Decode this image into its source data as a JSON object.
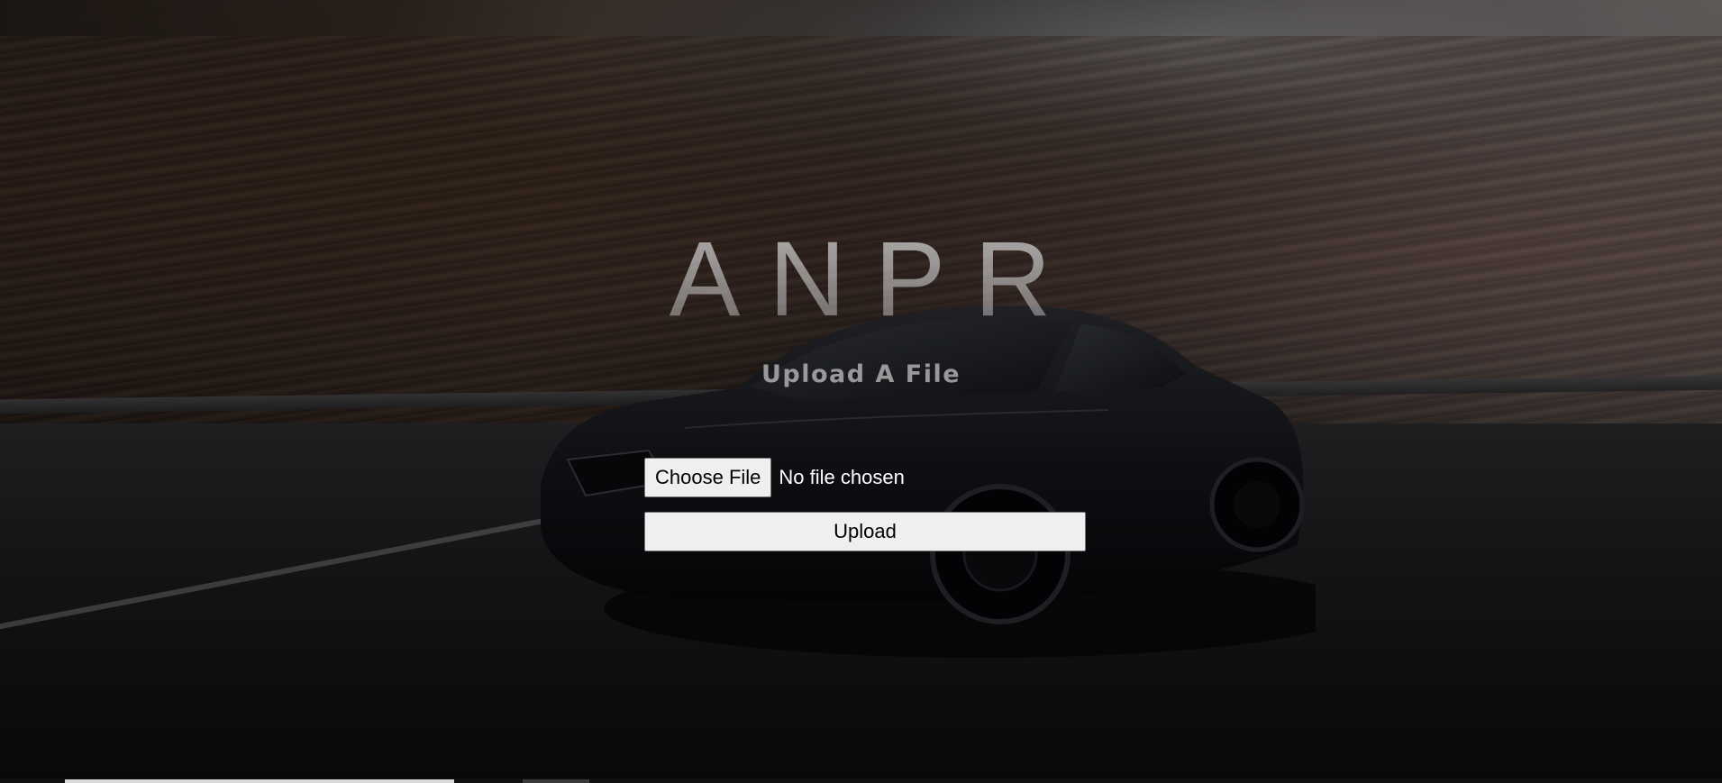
{
  "hero": {
    "title": "ANPR",
    "subtitle": "Upload A File"
  },
  "form": {
    "choose_file_label": "Choose File",
    "file_status": "No file chosen",
    "upload_label": "Upload"
  },
  "colors": {
    "button_bg": "#efefef",
    "button_border": "#767676",
    "title_text": "#c8c8c8",
    "subtitle_text": "#c3c3c3",
    "status_text": "#ffffff",
    "page_bg": "#0b0b0d"
  },
  "icons": {
    "background": "car-photo"
  }
}
